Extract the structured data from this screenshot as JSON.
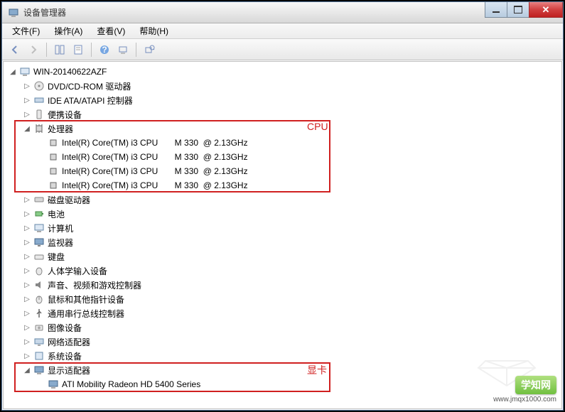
{
  "window": {
    "title": "设备管理器"
  },
  "menus": {
    "file": "文件(F)",
    "action": "操作(A)",
    "view": "查看(V)",
    "help": "帮助(H)"
  },
  "tree": {
    "root": "WIN-20140622AZF",
    "nodes": {
      "dvd": "DVD/CD-ROM 驱动器",
      "ide": "IDE ATA/ATAPI 控制器",
      "portable": "便携设备",
      "cpu": "处理器",
      "cpu_items": [
        "Intel(R) Core(TM) i3 CPU       M 330  @ 2.13GHz",
        "Intel(R) Core(TM) i3 CPU       M 330  @ 2.13GHz",
        "Intel(R) Core(TM) i3 CPU       M 330  @ 2.13GHz",
        "Intel(R) Core(TM) i3 CPU       M 330  @ 2.13GHz"
      ],
      "disk": "磁盘驱动器",
      "battery": "电池",
      "computer": "计算机",
      "monitor": "监视器",
      "keyboard": "键盘",
      "hid": "人体学输入设备",
      "sound": "声音、视频和游戏控制器",
      "mouse": "鼠标和其他指针设备",
      "usb": "通用串行总线控制器",
      "imaging": "图像设备",
      "network": "网络适配器",
      "system": "系统设备",
      "display": "显示适配器",
      "display_items": [
        "ATI Mobility Radeon HD 5400 Series"
      ]
    }
  },
  "highlights": {
    "cpu_label": "CPU",
    "gpu_label": "显卡"
  },
  "watermark": {
    "badge": "学知网",
    "url": "www.jmqx1000.com"
  }
}
